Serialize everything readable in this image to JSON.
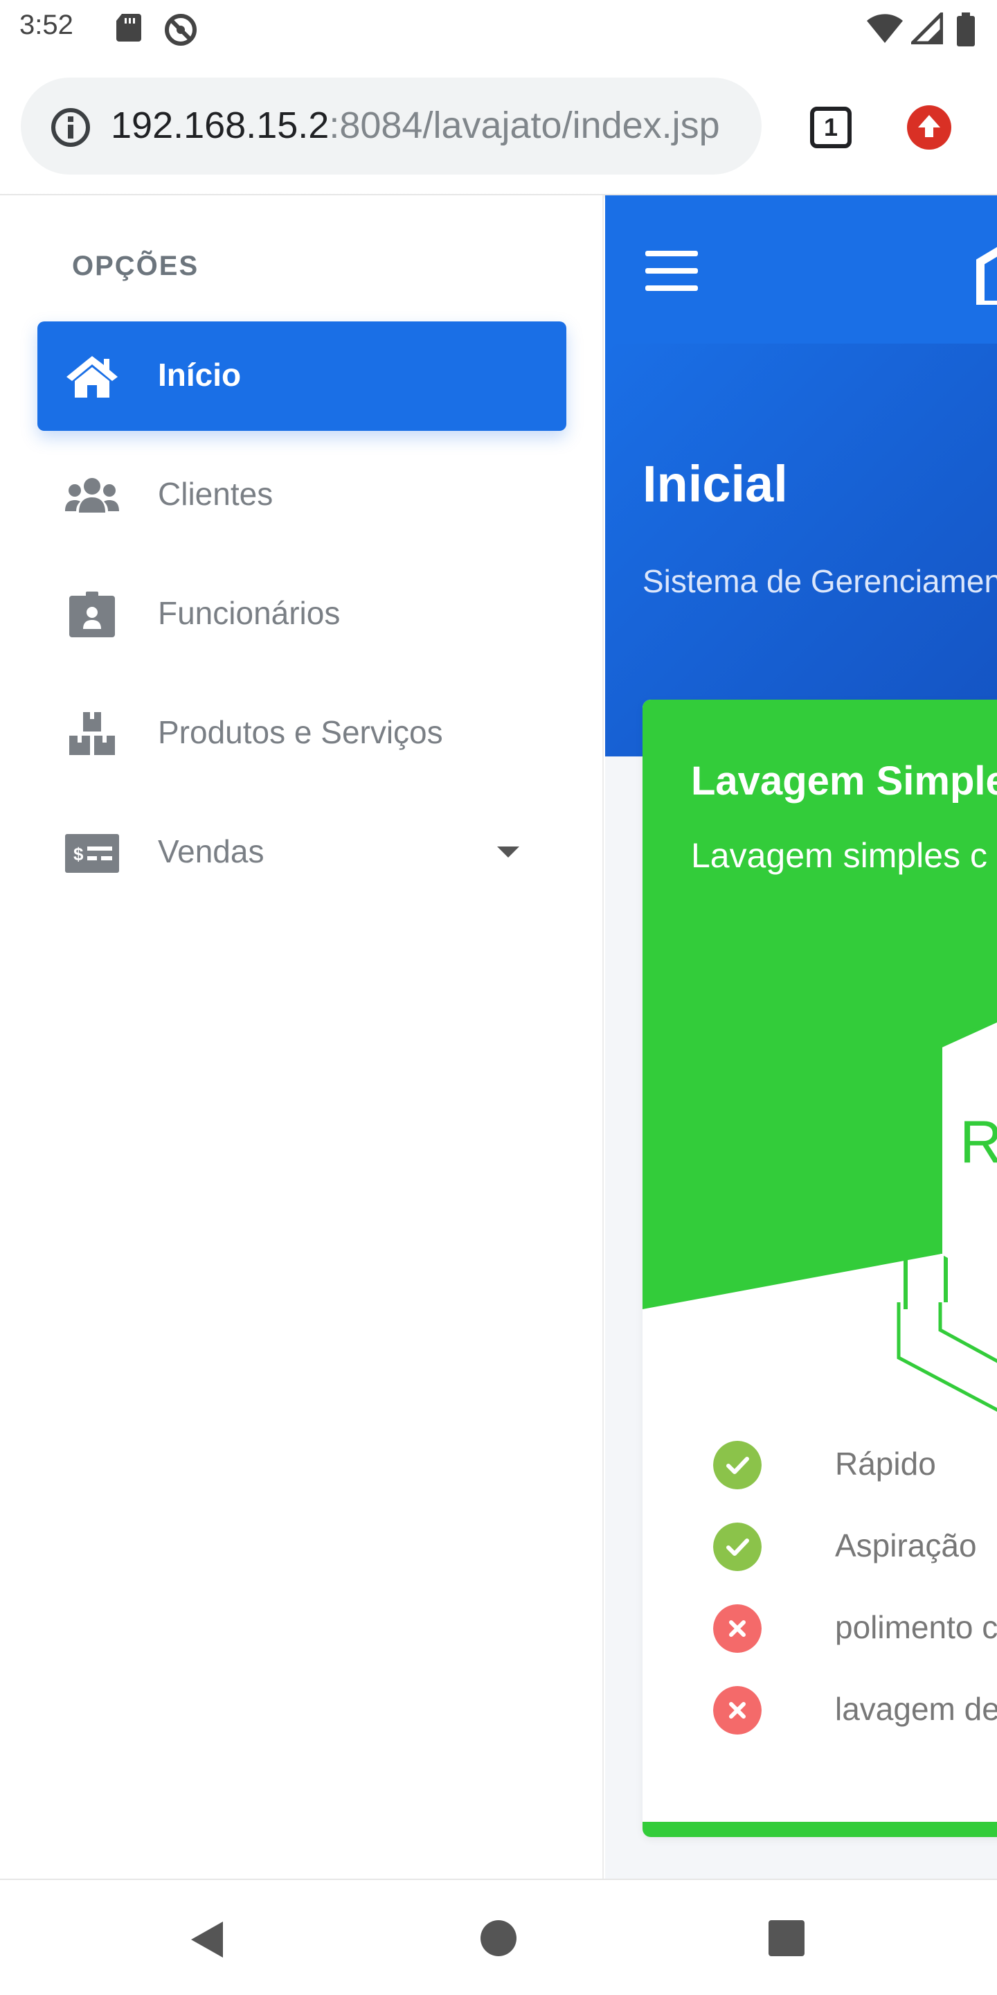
{
  "status_bar": {
    "time": "3:52",
    "icons": [
      "sd-card-icon",
      "do-not-disturb-icon",
      "wifi-icon",
      "signal-icon",
      "battery-icon"
    ]
  },
  "browser": {
    "url_host": "192.168.15.2",
    "url_path": ":8084/lavajato/index.jsp",
    "tab_count": "1",
    "icons": [
      "info-icon",
      "tabs-icon",
      "update-icon"
    ]
  },
  "sidebar": {
    "heading": "OPÇÕES",
    "items": [
      {
        "label": "Início",
        "icon": "home-icon",
        "active": true
      },
      {
        "label": "Clientes",
        "icon": "users-icon"
      },
      {
        "label": "Funcionários",
        "icon": "id-badge-icon"
      },
      {
        "label": "Produtos e Serviços",
        "icon": "boxes-icon"
      },
      {
        "label": "Vendas",
        "icon": "money-check-icon",
        "has_dropdown": true
      }
    ]
  },
  "main": {
    "page_title": "Inicial",
    "page_subtitle": "Sistema de Gerenciamento",
    "card": {
      "title": "Lavagem Simples",
      "subtitle": "Lavagem simples c",
      "price_fragment": "R",
      "features": [
        {
          "text": "Rápido",
          "included": true
        },
        {
          "text": "Aspiração",
          "included": true
        },
        {
          "text": "polimento c",
          "included": false
        },
        {
          "text": "lavagem de",
          "included": false
        }
      ]
    }
  },
  "colors": {
    "primary": "#1a6fe6",
    "green": "#33cc3a",
    "check": "#8bc34a",
    "cross": "#f46a6a",
    "muted_text": "#7a7f85"
  },
  "android_nav": [
    "back-icon",
    "home-circle-icon",
    "recents-icon"
  ]
}
